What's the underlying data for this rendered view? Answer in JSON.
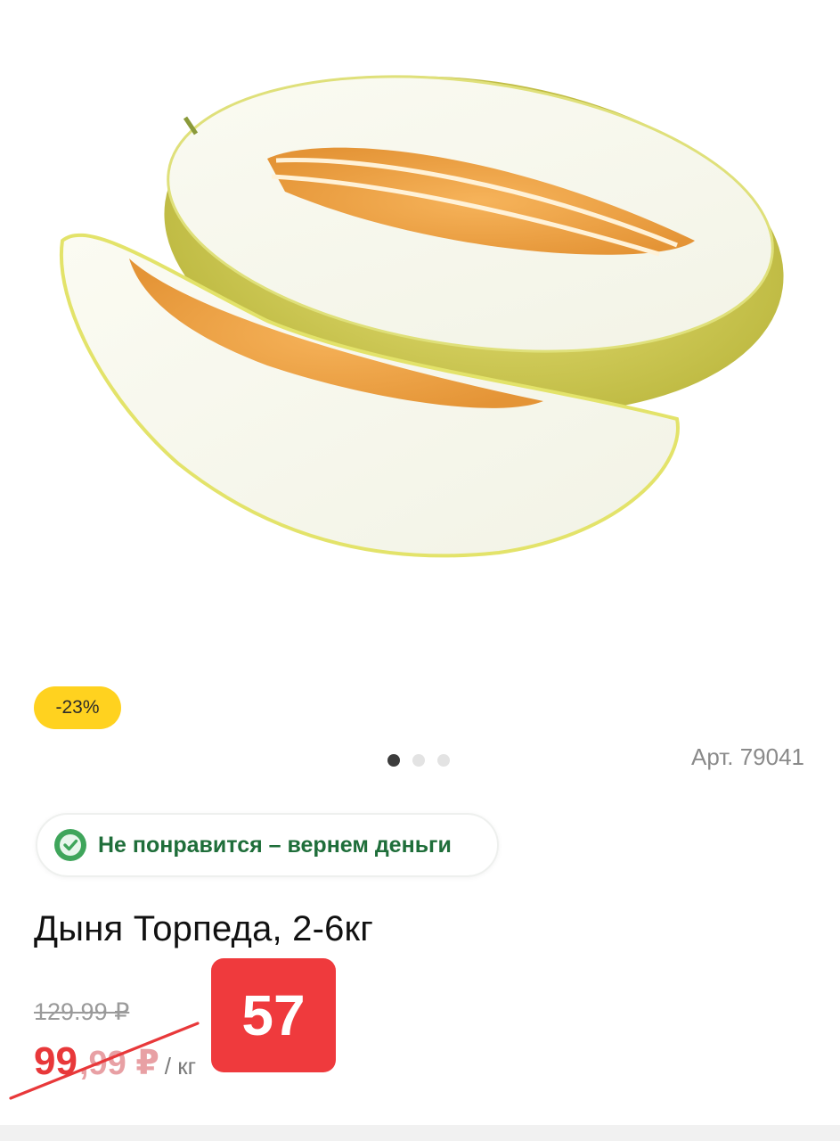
{
  "product": {
    "discount_badge": "-23%",
    "sku": "Арт. 79041",
    "guarantee_text": "Не понравится – вернем деньги",
    "title": "Дыня Торпеда, 2-6кг",
    "old_price": "129.99 ₽",
    "price_int": "99",
    "price_frac": ",99 ₽",
    "unit": "/ кг",
    "new_price_tag": "57"
  },
  "gallery": {
    "image_count": 3,
    "active_index": 0,
    "image_icon": "melon-photo"
  },
  "colors": {
    "badge": "#ffd21f",
    "accent_red": "#ef3a3d",
    "guarantee_green": "#1f6e3a"
  }
}
